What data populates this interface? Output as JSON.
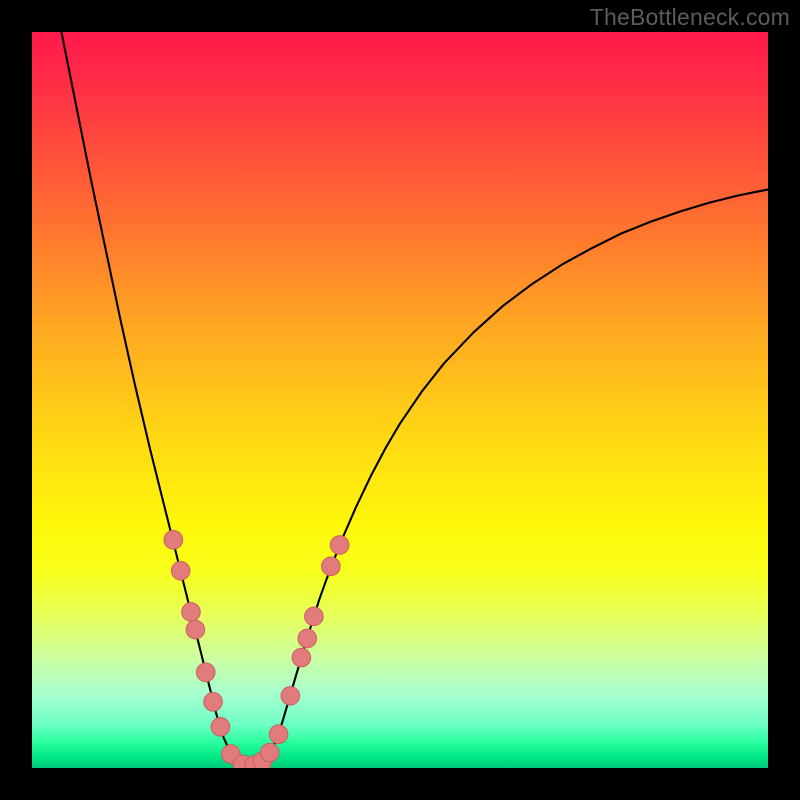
{
  "watermark": "TheBottleneck.com",
  "chart_data": {
    "type": "line",
    "title": "",
    "xlabel": "",
    "ylabel": "",
    "xlim": [
      0,
      100
    ],
    "ylim": [
      0,
      100
    ],
    "gradient_stops": [
      {
        "offset": 0.0,
        "color": "#ff1a4b"
      },
      {
        "offset": 0.06,
        "color": "#ff2a47"
      },
      {
        "offset": 0.24,
        "color": "#ff6a32"
      },
      {
        "offset": 0.4,
        "color": "#ffa722"
      },
      {
        "offset": 0.55,
        "color": "#ffd814"
      },
      {
        "offset": 0.67,
        "color": "#fff70a"
      },
      {
        "offset": 0.73,
        "color": "#f7ff1a"
      },
      {
        "offset": 0.79,
        "color": "#e7ff57"
      },
      {
        "offset": 0.85,
        "color": "#ccffa0"
      },
      {
        "offset": 0.9,
        "color": "#a6ffcf"
      },
      {
        "offset": 0.94,
        "color": "#6fffc6"
      },
      {
        "offset": 0.965,
        "color": "#2bff9f"
      },
      {
        "offset": 0.985,
        "color": "#00e887"
      },
      {
        "offset": 1.0,
        "color": "#00c878"
      }
    ],
    "series": [
      {
        "name": "curve",
        "stroke": "#000000",
        "stroke_width": 2.1,
        "points": [
          {
            "x": 4.0,
            "y": 100.0
          },
          {
            "x": 6.0,
            "y": 90.0
          },
          {
            "x": 8.0,
            "y": 80.0
          },
          {
            "x": 10.0,
            "y": 70.5
          },
          {
            "x": 12.0,
            "y": 61.0
          },
          {
            "x": 14.0,
            "y": 52.0
          },
          {
            "x": 16.0,
            "y": 43.5
          },
          {
            "x": 18.0,
            "y": 35.5
          },
          {
            "x": 19.0,
            "y": 31.5
          },
          {
            "x": 20.0,
            "y": 27.5
          },
          {
            "x": 21.0,
            "y": 23.5
          },
          {
            "x": 22.0,
            "y": 19.5
          },
          {
            "x": 23.0,
            "y": 15.5
          },
          {
            "x": 24.0,
            "y": 11.5
          },
          {
            "x": 25.0,
            "y": 7.5
          },
          {
            "x": 26.0,
            "y": 4.2
          },
          {
            "x": 27.0,
            "y": 2.0
          },
          {
            "x": 28.0,
            "y": 0.8
          },
          {
            "x": 29.0,
            "y": 0.3
          },
          {
            "x": 30.0,
            "y": 0.3
          },
          {
            "x": 31.0,
            "y": 0.6
          },
          {
            "x": 32.0,
            "y": 1.6
          },
          {
            "x": 33.0,
            "y": 3.4
          },
          {
            "x": 34.0,
            "y": 6.2
          },
          {
            "x": 35.0,
            "y": 9.6
          },
          {
            "x": 36.0,
            "y": 13.0
          },
          {
            "x": 37.0,
            "y": 16.4
          },
          {
            "x": 38.0,
            "y": 19.6
          },
          {
            "x": 39.0,
            "y": 22.8
          },
          {
            "x": 40.0,
            "y": 25.6
          },
          {
            "x": 42.0,
            "y": 30.8
          },
          {
            "x": 44.0,
            "y": 35.4
          },
          {
            "x": 46.0,
            "y": 39.6
          },
          {
            "x": 48.0,
            "y": 43.4
          },
          {
            "x": 50.0,
            "y": 46.8
          },
          {
            "x": 53.0,
            "y": 51.2
          },
          {
            "x": 56.0,
            "y": 55.0
          },
          {
            "x": 60.0,
            "y": 59.2
          },
          {
            "x": 64.0,
            "y": 62.8
          },
          {
            "x": 68.0,
            "y": 65.8
          },
          {
            "x": 72.0,
            "y": 68.4
          },
          {
            "x": 76.0,
            "y": 70.6
          },
          {
            "x": 80.0,
            "y": 72.6
          },
          {
            "x": 84.0,
            "y": 74.2
          },
          {
            "x": 88.0,
            "y": 75.6
          },
          {
            "x": 92.0,
            "y": 76.8
          },
          {
            "x": 96.0,
            "y": 77.8
          },
          {
            "x": 100.0,
            "y": 78.6
          }
        ]
      }
    ],
    "markers": {
      "fill": "#e27b7b",
      "stroke": "#c96060",
      "r": 9.3,
      "points": [
        {
          "x": 19.2,
          "y": 31.0
        },
        {
          "x": 20.2,
          "y": 26.8
        },
        {
          "x": 21.6,
          "y": 21.2
        },
        {
          "x": 22.2,
          "y": 18.8
        },
        {
          "x": 23.6,
          "y": 13.0
        },
        {
          "x": 24.6,
          "y": 9.0
        },
        {
          "x": 25.6,
          "y": 5.6
        },
        {
          "x": 27.0,
          "y": 1.9
        },
        {
          "x": 28.6,
          "y": 0.5
        },
        {
          "x": 30.2,
          "y": 0.4
        },
        {
          "x": 31.3,
          "y": 0.9
        },
        {
          "x": 32.3,
          "y": 2.1
        },
        {
          "x": 33.5,
          "y": 4.6
        },
        {
          "x": 35.1,
          "y": 9.8
        },
        {
          "x": 36.6,
          "y": 15.0
        },
        {
          "x": 37.4,
          "y": 17.6
        },
        {
          "x": 38.3,
          "y": 20.6
        },
        {
          "x": 40.6,
          "y": 27.4
        },
        {
          "x": 41.8,
          "y": 30.3
        }
      ]
    }
  }
}
